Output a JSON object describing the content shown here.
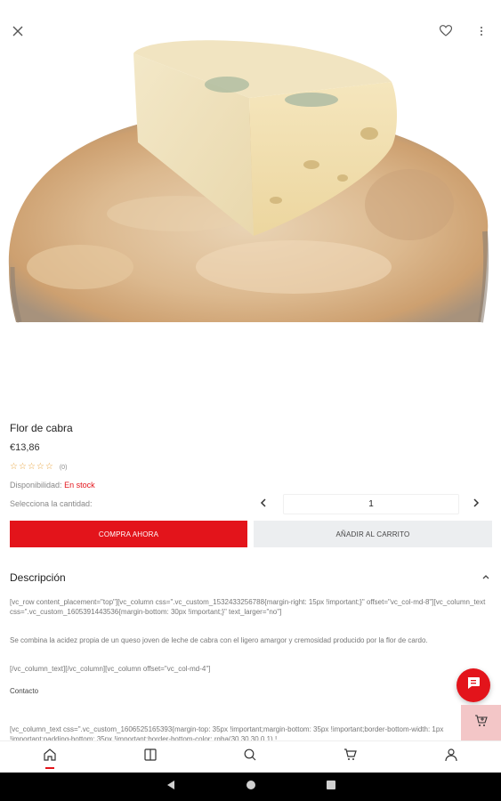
{
  "product": {
    "title": "Flor de cabra",
    "price": "€13,86",
    "rating_stars": 0,
    "rating_count": "(0)",
    "availability_label": "Disponibilidad:",
    "availability_value": "En stock",
    "quantity_label": "Selecciona la cantidad:",
    "quantity_value": "1",
    "buy_now_label": "COMPRA AHORA",
    "add_to_cart_label": "AÑADIR AL CARRITO"
  },
  "description": {
    "heading": "Descripción",
    "paragraphs": [
      "[vc_row content_placement=\"top\"][vc_column css=\".vc_custom_1532433256788{margin-right: 15px !important;}\" offset=\"vc_col-md-8\"][vc_column_text css=\".vc_custom_1605391443536{margin-bottom: 30px !important;}\" text_larger=\"no\"]",
      "Se combina la acidez propia de un queso joven de leche de cabra con el ligero amargor y cremosidad producido por la flor de cardo.",
      "[/vc_column_text][/vc_column][vc_column offset=\"vc_col-md-4\"]",
      "Contacto",
      "[vc_column_text css=\".vc_custom_1606525165393{margin-top: 35px !important;margin-bottom: 35px !important;border-bottom-width: 1px !important;padding-bottom: 35px !important;border-bottom-color: rgba(30,30,30,0.1) !"
    ]
  },
  "colors": {
    "accent": "#e3141b",
    "secondary_button": "#eceef0",
    "star": "#e8a33d"
  },
  "icons": {
    "top_left": "close-icon",
    "top_right_1": "heart-icon",
    "top_right_2": "more-vertical-icon",
    "nav": [
      "home-icon",
      "catalog-icon",
      "search-icon",
      "cart-icon",
      "user-icon"
    ]
  }
}
